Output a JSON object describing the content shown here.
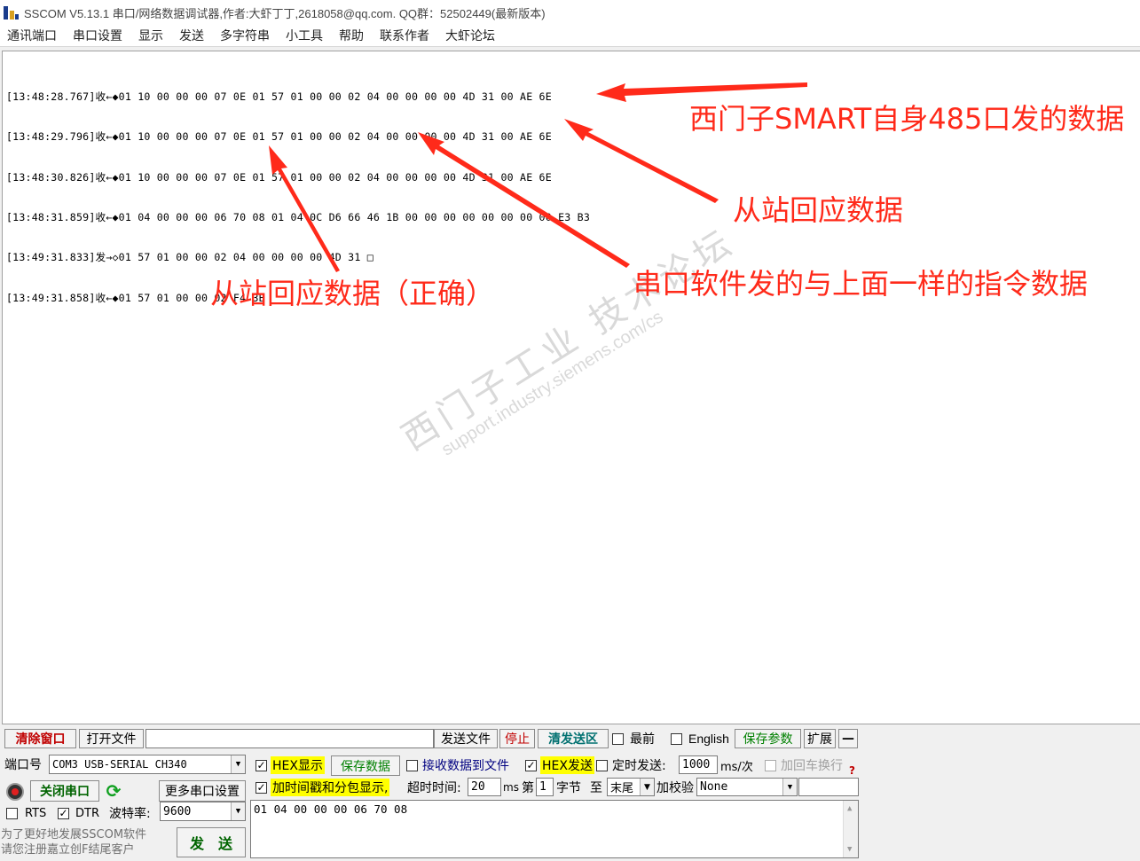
{
  "window": {
    "title": "SSCOM V5.13.1 串口/网络数据调试器,作者:大虾丁丁,2618058@qq.com. QQ群：52502449(最新版本)"
  },
  "menu": {
    "items": [
      "通讯端口",
      "串口设置",
      "显示",
      "发送",
      "多字符串",
      "小工具",
      "帮助",
      "联系作者",
      "大虾论坛"
    ]
  },
  "log": {
    "lines": [
      "[13:48:28.767]收←◆01 10 00 00 00 07 0E 01 57 01 00 00 02 04 00 00 00 00 4D 31 00 AE 6E",
      "[13:48:29.796]收←◆01 10 00 00 00 07 0E 01 57 01 00 00 02 04 00 00 00 00 4D 31 00 AE 6E",
      "[13:48:30.826]收←◆01 10 00 00 00 07 0E 01 57 01 00 00 02 04 00 00 00 00 4D 31 00 AE 6E",
      "[13:48:31.859]收←◆01 04 00 00 00 06 70 08 01 04 0C D6 66 46 1B 00 00 00 00 00 00 00 00 E3 B3",
      "[13:49:31.833]发→◇01 57 01 00 00 02 04 00 00 00 00 4D 31 □",
      "[13:49:31.858]收←◆01 57 01 00 00 02 F4 3B"
    ]
  },
  "watermark": {
    "cn": "西门子工业 技术论坛",
    "url": "support.industry.siemens.com/cs"
  },
  "annotations": {
    "a1": "西门子SMART自身485口发的数据",
    "a2": "从站回应数据",
    "a3": "从站回应数据（正确）",
    "a4": "串口软件发的与上面一样的指令数据"
  },
  "toolbar": {
    "clear_window": "清除窗口",
    "open_file": "打开文件",
    "file_path": "",
    "send_file": "发送文件",
    "stop": "停止",
    "clear_send": "清发送区",
    "topmost": "最前",
    "english": "English",
    "save_params": "保存参数",
    "expand": "扩展",
    "collapse": "—"
  },
  "port": {
    "port_label": "端口号",
    "port_value": "COM3 USB-SERIAL CH340",
    "close_port": "关闭串口",
    "more_settings": "更多串口设置",
    "rts": "RTS",
    "dtr": "DTR",
    "baud_label": "波特率:",
    "baud_value": "9600"
  },
  "options": {
    "hex_display": "HEX显示",
    "save_data": "保存数据",
    "recv_to_file": "接收数据到文件",
    "hex_send": "HEX发送",
    "timed_send": "定时发送:",
    "interval": "1000",
    "interval_unit": "ms/次",
    "add_crlf": "加回车换行",
    "timestamp": "加时间戳和分包显示,",
    "timeout_label": "超时时间:",
    "timeout_value": "20",
    "timeout_unit": "ms",
    "byte_label_a": "第",
    "byte_value": "1",
    "byte_label_b": "字节",
    "to_label": "至",
    "to_value": "末尾",
    "checksum_label": "加校验",
    "checksum_value": "None",
    "help_mark": "?"
  },
  "send": {
    "text": "01 04 00 00 00 06 70 08",
    "send_button": "发　送"
  },
  "hint": {
    "line1": "为了更好地发展SSCOM软件",
    "line2": "请您注册嘉立创F结尾客户"
  },
  "colors": {
    "annotation": "#ff2a1a",
    "highlight": "#ffff00",
    "clear_window_text": "#c00000"
  }
}
